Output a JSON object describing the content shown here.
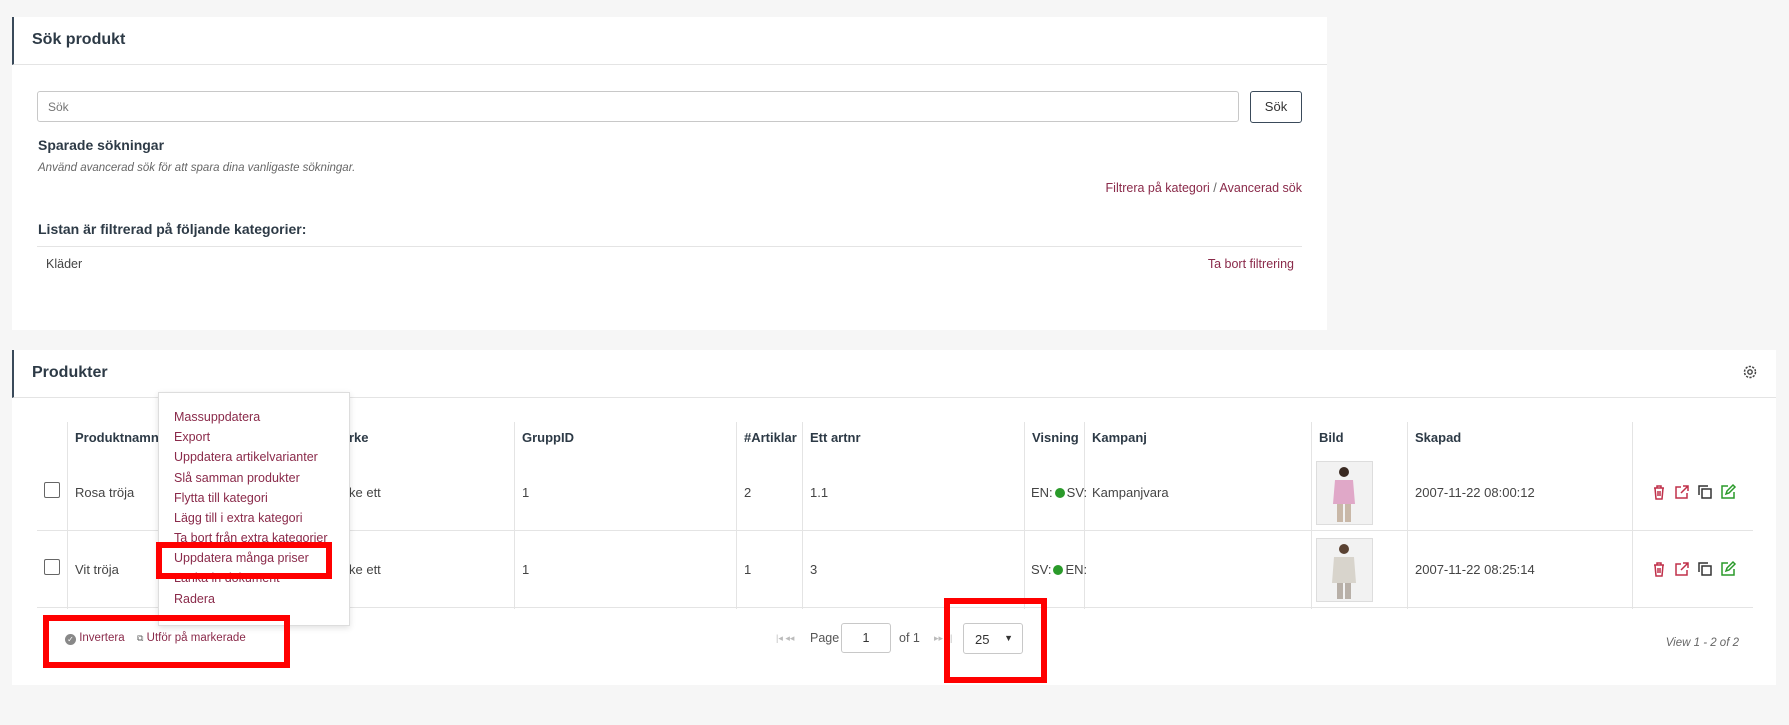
{
  "search_panel": {
    "title": "Sök produkt",
    "search_placeholder": "Sök",
    "search_button": "Sök",
    "saved_title": "Sparade sökningar",
    "saved_hint": "Använd avancerad sök för att spara dina vanligaste sökningar.",
    "filter_category_link": "Filtrera på kategori",
    "separator": "/",
    "advanced_search_link": "Avancerad sök",
    "filtered_title": "Listan är filtrerad på följande kategorier:",
    "filtered_category": "Kläder",
    "remove_filter_link": "Ta bort filtrering"
  },
  "products_panel": {
    "title": "Produkter",
    "columns": [
      "Produktnamn",
      "rke",
      "GruppID",
      "#Artiklar",
      "Ett artnr",
      "Visning",
      "Kampanj",
      "Bild",
      "Skapad"
    ],
    "rows": [
      {
        "name": "Rosa tröja",
        "brand": "ke ett",
        "group": "1",
        "articles": "2",
        "artnr": "1.1",
        "vis_a": "EN:",
        "vis_b": "SV:",
        "campaign": "Kampanjvara",
        "created": "2007-11-22 08:00:12"
      },
      {
        "name": "Vit tröja",
        "brand": "ke ett",
        "group": "1",
        "articles": "1",
        "artnr": "3",
        "vis_a": "SV:",
        "vis_b": "EN:",
        "campaign": "",
        "created": "2007-11-22 08:25:14"
      }
    ],
    "footer": {
      "invert": "Invertera",
      "apply_selected": "Utför på markerade",
      "page_label": "Page",
      "page_value": "1",
      "of_label": "of 1",
      "page_size": "25",
      "view_info": "View 1 - 2 of 2"
    }
  },
  "action_menu": {
    "items": [
      "Massuppdatera",
      "Export",
      "Uppdatera artikelvarianter",
      "Slå samman produkter",
      "Flytta till kategori",
      "Lägg till i extra kategori",
      "Ta bort från extra kategorier",
      "Uppdatera många priser",
      "Länka in dokument",
      "Radera"
    ]
  },
  "colors": {
    "link": "#8a2a4a",
    "highlight": "#ff0000",
    "status_green": "#2a9a2a",
    "icon_delete": "#c0304a",
    "icon_edit": "#2a9a2a"
  }
}
